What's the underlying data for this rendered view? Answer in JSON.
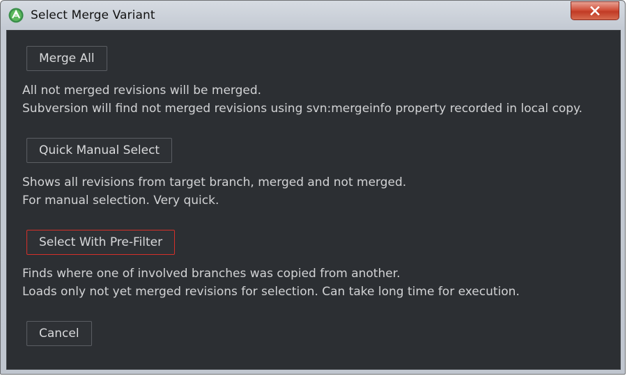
{
  "window": {
    "title": "Select Merge Variant",
    "icon": "android-studio-icon",
    "close_icon": "close-icon"
  },
  "options": [
    {
      "button_label": "Merge All",
      "lines": [
        "All not merged revisions will be merged.",
        "Subversion will find not merged revisions using svn:mergeinfo property recorded in local copy."
      ]
    },
    {
      "button_label": "Quick Manual Select",
      "lines": [
        "Shows all revisions from target branch, merged and not merged.",
        "For manual selection. Very quick."
      ]
    },
    {
      "button_label": "Select With Pre-Filter",
      "focused": true,
      "lines": [
        "Finds where one of involved branches was copied from another.",
        "Loads only not yet merged revisions for selection. Can take long time for execution."
      ]
    }
  ],
  "cancel_label": "Cancel",
  "colors": {
    "background": "#2c2f33",
    "text": "#d2d3d5",
    "focus_border": "#d6302a",
    "button_border": "#5b5e63"
  }
}
